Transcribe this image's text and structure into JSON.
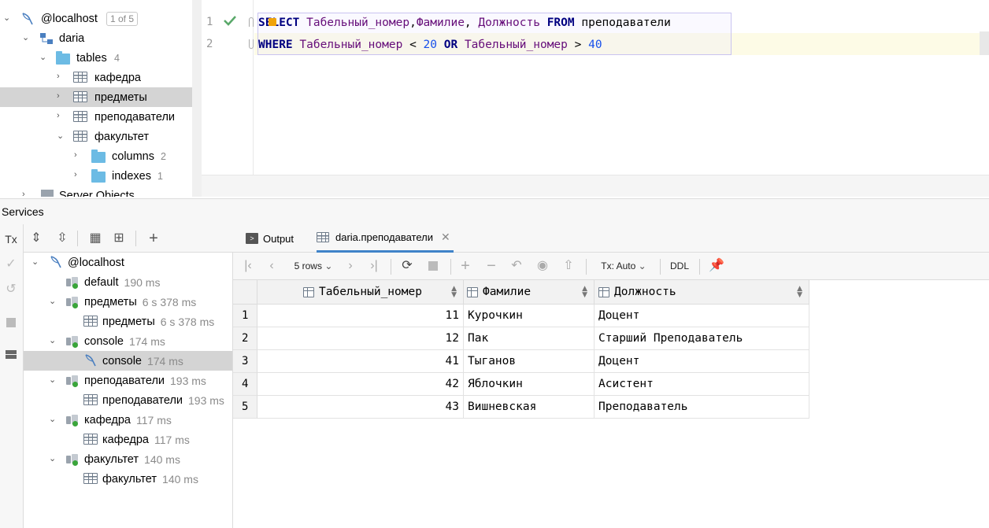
{
  "db_tree": {
    "root": {
      "label": "@localhost",
      "badge": "1 of 5"
    },
    "schema": {
      "label": "daria"
    },
    "tables_folder": {
      "label": "tables",
      "count": "4"
    },
    "tables": [
      "кафедра",
      "предметы",
      "преподаватели",
      "факультет"
    ],
    "selected_table": "предметы",
    "subfolders": [
      {
        "label": "columns",
        "count": "2"
      },
      {
        "label": "indexes",
        "count": "1"
      }
    ],
    "server_objects": "Server Objects"
  },
  "editor": {
    "line_numbers": [
      "1",
      "2"
    ],
    "line1": {
      "kw1": "SELECT",
      "c1": " Табельный_номер",
      "p1": ",",
      "c2": "Фамилие",
      "p2": ", ",
      "c3": "Должность",
      "s1": " ",
      "kw2": "FROM",
      "t1": " преподаватели"
    },
    "line2": {
      "kw1": "WHERE",
      "c1": " Табельный_номер",
      "op1": " < ",
      "n1": "20",
      "s1": " ",
      "kw2": "OR",
      "c2": " Табельный_номер",
      "op2": " > ",
      "n2": "40"
    }
  },
  "services": {
    "title": "Services",
    "tx_label": "Tx",
    "root": "@localhost",
    "nodes": [
      {
        "label": "default",
        "time": "190 ms",
        "level": 2
      },
      {
        "label": "предметы",
        "time": "6 s 378 ms",
        "level": 2
      },
      {
        "label": "предметы",
        "time": "6 s 378 ms",
        "level": 3
      },
      {
        "label": "console",
        "time": "174 ms",
        "level": 2
      },
      {
        "label": "console",
        "time": "174 ms",
        "level": 3
      },
      {
        "label": "преподаватели",
        "time": "193 ms",
        "level": 2
      },
      {
        "label": "преподаватели",
        "time": "193 ms",
        "level": 3
      },
      {
        "label": "кафедра",
        "time": "117 ms",
        "level": 2
      },
      {
        "label": "кафедра",
        "time": "117 ms",
        "level": 3
      },
      {
        "label": "факультет",
        "time": "140 ms",
        "level": 2
      },
      {
        "label": "факультет",
        "time": "140 ms",
        "level": 3
      }
    ]
  },
  "result": {
    "tabs": [
      {
        "label": "Output"
      },
      {
        "label": "daria.преподаватели"
      }
    ],
    "rows_label": "5 rows",
    "tx_mode": "Tx: Auto",
    "ddl": "DDL",
    "columns": [
      "Табельный_номер",
      "Фамилие",
      "Должность"
    ],
    "rows": [
      {
        "n": "1",
        "id": "11",
        "surname": "Курочкин",
        "position": "Доцент"
      },
      {
        "n": "2",
        "id": "12",
        "surname": "Пак",
        "position": "Старший Преподаватель"
      },
      {
        "n": "3",
        "id": "41",
        "surname": "Тыганов",
        "position": "Доцент"
      },
      {
        "n": "4",
        "id": "42",
        "surname": "Яблочкин",
        "position": "Асистент"
      },
      {
        "n": "5",
        "id": "43",
        "surname": "Вишневская",
        "position": "Преподаватель"
      }
    ]
  },
  "colors": {
    "accent": "#4083c9",
    "keyword": "#000080",
    "identifier": "#660e7a",
    "number": "#1750eb",
    "running": "#3aa53a"
  }
}
